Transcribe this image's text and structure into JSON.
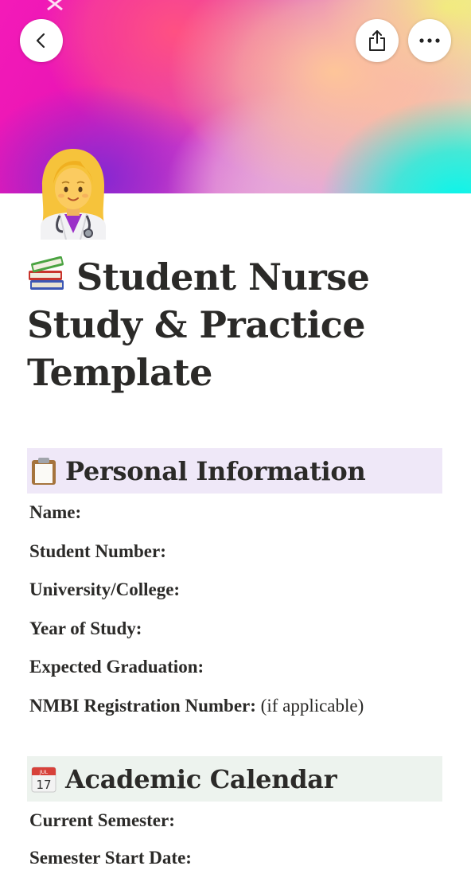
{
  "toolbar": {
    "back_icon": "chevron-left-icon",
    "share_icon": "share-icon",
    "more_icon": "ellipsis-icon"
  },
  "cover": {
    "colors": [
      "#f41ab8",
      "#8228d2",
      "#ff5082",
      "#f7b8b3",
      "#f0f578",
      "#0af5eb"
    ]
  },
  "page": {
    "icon": "nurse-emoji",
    "title_icon": "books-emoji",
    "title": "Student Nurse Study & Practice Template"
  },
  "sections": {
    "personal": {
      "icon": "clipboard-emoji",
      "heading": "Personal Information",
      "background": "#efe8f8",
      "fields": [
        {
          "label": "Name:"
        },
        {
          "label": "Student Number:"
        },
        {
          "label": "University/College:"
        },
        {
          "label": "Year of Study:"
        },
        {
          "label": "Expected Graduation:"
        },
        {
          "label": "NMBI Registration Number:",
          "note": "(if applicable)"
        }
      ]
    },
    "calendar": {
      "icon": "calendar-emoji",
      "heading": "Academic Calendar",
      "calendar_month": "JUL",
      "calendar_day": "17",
      "background": "#edf3ee",
      "fields": [
        {
          "label": "Current Semester:"
        },
        {
          "label": "Semester Start Date:"
        }
      ]
    }
  }
}
